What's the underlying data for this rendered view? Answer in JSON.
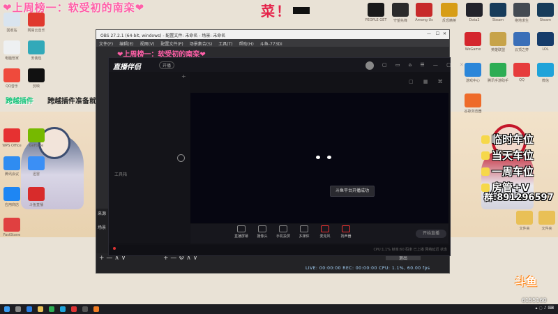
{
  "banner": {
    "text": "❤上周榜一：软受初的南栾❤",
    "cai": "菜！"
  },
  "desktop_left": [
    {
      "label": "回收站",
      "color": "#d9e4ef"
    },
    {
      "label": "网易云音乐",
      "color": "#e0392e"
    },
    {
      "label": "电脑管家",
      "color": "#eef0f2"
    },
    {
      "label": "安装包",
      "color": "#32a9b9"
    },
    {
      "label": "QQ音乐",
      "color": "#ef4a3c"
    },
    {
      "label": "剪映",
      "color": "#111111"
    },
    {
      "label": "WPS Office",
      "color": "#e63131"
    },
    {
      "label": "GeForce",
      "color": "#76b900"
    },
    {
      "label": "腾讯会议",
      "color": "#2f8cf1"
    },
    {
      "label": "迅雷",
      "color": "#3b8ff5"
    },
    {
      "label": "应用商店",
      "color": "#1e86f3"
    },
    {
      "label": "斗鱼直播",
      "color": "#d82b2b"
    },
    {
      "label": "FastStone",
      "color": "#e04040"
    }
  ],
  "desktop_top_right": [
    {
      "label": "PEOPLE GET",
      "color": "#1a1a1a"
    },
    {
      "label": "守望先锋",
      "color": "#2b2b2b"
    },
    {
      "label": "Among Us",
      "color": "#c72a2a"
    },
    {
      "label": "反恐精英",
      "color": "#d79d16"
    },
    {
      "label": "Dota2",
      "color": "#22232b"
    },
    {
      "label": "Steam",
      "color": "#173c5a"
    },
    {
      "label": "绝地求生",
      "color": "#444b52"
    },
    {
      "label": "Steam",
      "color": "#173c5a"
    }
  ],
  "desktop_right_rows": [
    {
      "label": "WeGame",
      "color": "#d4262d"
    },
    {
      "label": "英雄联盟",
      "color": "#c7a349"
    },
    {
      "label": "云顶之弈",
      "color": "#3a6fb8"
    },
    {
      "label": "LOL",
      "color": "#163c6a"
    },
    {
      "label": "游戏中心",
      "color": "#2b86d9"
    },
    {
      "label": "腾讯手游助手",
      "color": "#2dad54"
    },
    {
      "label": "QQ",
      "color": "#e63c3c"
    },
    {
      "label": "微信",
      "color": "#1fa3d9"
    },
    {
      "label": "谷歌浏览器",
      "color": "#ee6b2a"
    },
    {
      "label": "文件夹",
      "color": "#e9c056"
    },
    {
      "label": "文件夹",
      "color": "#e9c056"
    }
  ],
  "left_note": {
    "green": "跨越插件",
    "black": "跨越插件准备就绪！"
  },
  "obs": {
    "title": "OBS 27.2.1 (64-bit, windows) - 配置文件: 未命名 - 场景: 未命名",
    "menus": [
      "文件(F)",
      "编辑(E)",
      "视图(V)",
      "配置文件(P)",
      "场景集合(S)",
      "工具(T)",
      "帮助(H)",
      "斗鱼-773Di"
    ],
    "ticker": "❤上周榜一：软受初的南栾❤",
    "status": "LIVE: 00:00:00  REC: 00:00:00  CPU: 1.1%, 60.00 fps",
    "left_labels": [
      "来源",
      "场景"
    ]
  },
  "zb": {
    "logo": "直播伴侣",
    "badge": "开播",
    "side_label": "工具箱",
    "toast": "斗鱼平台开播成功",
    "tools": [
      "直播屏幕",
      "摄像头",
      "手机投屏",
      "多媒体",
      "麦克风",
      "扬声器"
    ],
    "start": "开始直播",
    "footer": "CPU:1.1%  帧率:60  码率  已上播  网络延迟  状态"
  },
  "overlay": {
    "items": [
      "临时车位",
      "当天车位",
      "一周车位",
      "房管+V"
    ],
    "qq_prefix": "群:",
    "qq": "891296597"
  },
  "douyu": {
    "logo": "斗鱼",
    "room": "6155160"
  },
  "taskbar": {
    "time": ""
  }
}
